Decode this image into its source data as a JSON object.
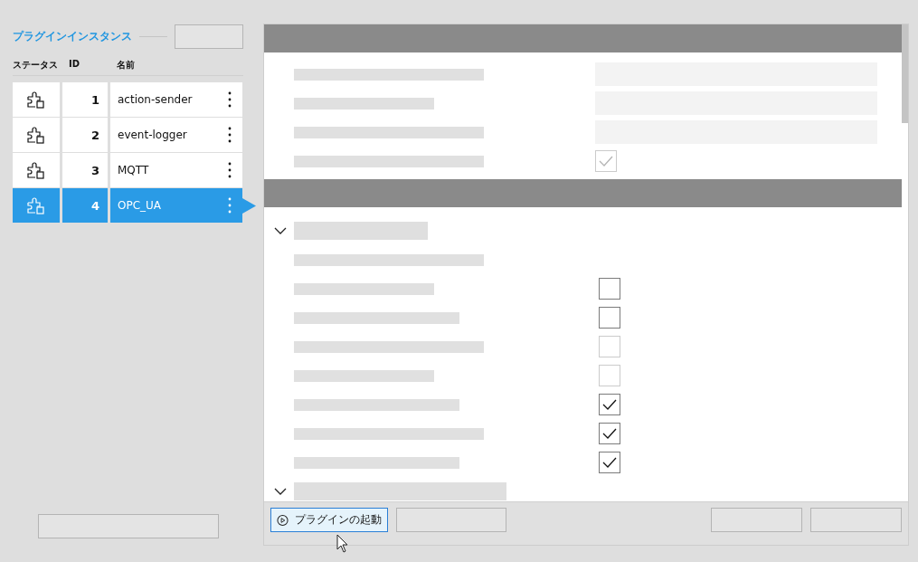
{
  "sidebar": {
    "title": "プラグインインスタンス",
    "columns": [
      "ステータス",
      "ID",
      "名前"
    ],
    "instances": [
      {
        "id": "1",
        "name": "action-sender",
        "selected": false
      },
      {
        "id": "2",
        "name": "event-logger",
        "selected": false
      },
      {
        "id": "3",
        "name": "MQTT",
        "selected": false
      },
      {
        "id": "4",
        "name": "OPC_UA",
        "selected": true
      }
    ]
  },
  "form": {
    "sections": [
      {
        "kind": "fields",
        "rows": [
          {
            "kind": "field"
          },
          {
            "kind": "field"
          },
          {
            "kind": "field"
          },
          {
            "kind": "checkbox",
            "checked": true,
            "disabled": true
          }
        ]
      },
      {
        "kind": "groups",
        "groups": [
          {
            "expanded": true,
            "rows": [
              {
                "kind": "label"
              },
              {
                "kind": "checkbox",
                "checked": false,
                "disabled": false
              },
              {
                "kind": "checkbox",
                "checked": false,
                "disabled": false
              },
              {
                "kind": "checkbox",
                "checked": false,
                "disabled": true
              },
              {
                "kind": "checkbox",
                "checked": false,
                "disabled": true
              },
              {
                "kind": "checkbox",
                "checked": true,
                "disabled": false
              },
              {
                "kind": "checkbox",
                "checked": true,
                "disabled": false
              },
              {
                "kind": "checkbox",
                "checked": true,
                "disabled": false
              }
            ]
          },
          {
            "expanded": true
          }
        ]
      }
    ]
  },
  "footer": {
    "start_button": {
      "label": "プラグインの起動",
      "highlighted": true
    }
  }
}
